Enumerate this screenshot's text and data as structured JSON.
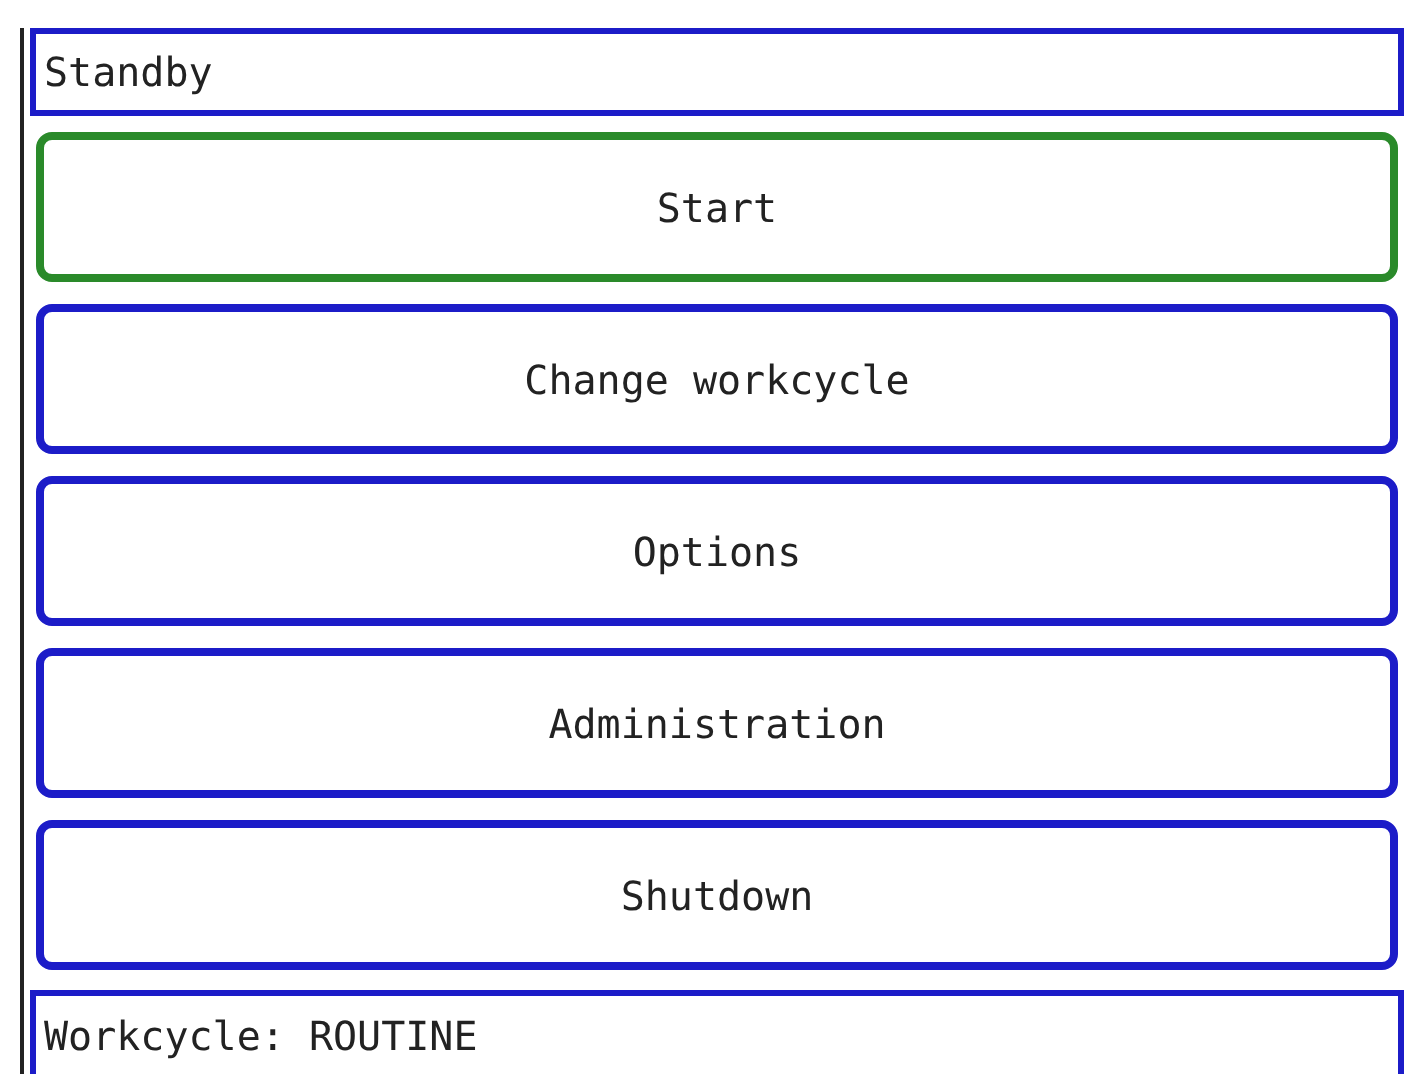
{
  "status": {
    "text": "Standby"
  },
  "menu": [
    {
      "label": "Start",
      "selected": true
    },
    {
      "label": "Change workcycle",
      "selected": false
    },
    {
      "label": "Options",
      "selected": false
    },
    {
      "label": "Administration",
      "selected": false
    },
    {
      "label": "Shutdown",
      "selected": false
    }
  ],
  "footer": {
    "text": "Workcycle: ROUTINE"
  }
}
